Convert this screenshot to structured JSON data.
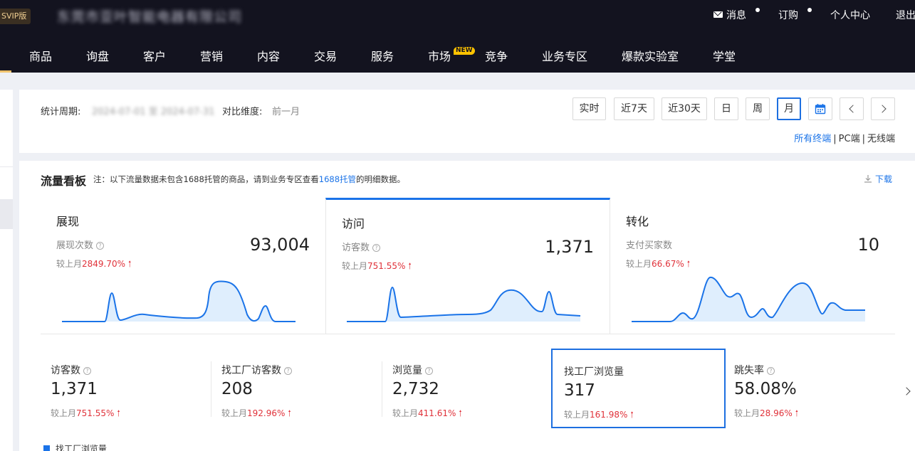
{
  "header": {
    "badge": "SVIP版",
    "company": "东莞市亚叶智能电器有限公司",
    "links": [
      {
        "label": "消息",
        "icon": "mail-icon"
      },
      {
        "label": "订购"
      },
      {
        "label": "个人中心"
      },
      {
        "label": "退出"
      }
    ]
  },
  "nav": {
    "items": [
      "商品",
      "询盘",
      "客户",
      "营销",
      "内容",
      "交易",
      "服务",
      "市场",
      "竞争",
      "业务专区",
      "爆款实验室",
      "学堂"
    ],
    "new_badge": "NEW"
  },
  "filter": {
    "period_label": "统计周期:",
    "period_value": "2024-07-01 至 2024-07-31",
    "compare_label": "对比维度:",
    "compare_value": "前一月",
    "buttons": [
      "实时",
      "近7天",
      "近30天",
      "日",
      "周",
      "月"
    ],
    "active_button": "月",
    "terminals": [
      "所有终端",
      "PC端",
      "无线端"
    ],
    "active_terminal": "所有终端",
    "separator": "|"
  },
  "dashboard": {
    "title": "流量看板",
    "note_prefix": "注：以下流量数据未包含1688托管的商品，请到业务专区查看",
    "note_link": "1688托管",
    "note_suffix": "的明细数据。",
    "download": "下载",
    "cards": [
      {
        "title": "展现",
        "metric": "展现次数",
        "value": "93,004",
        "compare_label": "较上月",
        "compare_value": "2849.70%",
        "help": "?"
      },
      {
        "title": "访问",
        "metric": "访客数",
        "value": "1,371",
        "compare_label": "较上月",
        "compare_value": "751.55%",
        "help": "?"
      },
      {
        "title": "转化",
        "metric": "支付买家数",
        "value": "10",
        "compare_label": "较上月",
        "compare_value": "66.67%",
        "help": ""
      }
    ],
    "metrics": [
      {
        "title": "访客数",
        "value": "1,371",
        "compare_label": "较上月",
        "compare_value": "751.55%",
        "help": "?"
      },
      {
        "title": "找工厂访客数",
        "value": "208",
        "compare_label": "较上月",
        "compare_value": "192.96%",
        "help": "?"
      },
      {
        "title": "浏览量",
        "value": "2,732",
        "compare_label": "较上月",
        "compare_value": "411.61%",
        "help": "?"
      },
      {
        "title": "找工厂浏览量",
        "value": "317",
        "compare_label": "较上月",
        "compare_value": "161.98%",
        "help": ""
      },
      {
        "title": "跳失率",
        "value": "58.08%",
        "compare_label": "较上月",
        "compare_value": "28.96%",
        "help": "?"
      }
    ],
    "selected_metric": "找工厂浏览量",
    "legend": "找工厂浏览量"
  },
  "colors": {
    "accent": "#1a73e8",
    "up": "#e0323a",
    "header_bg": "#13131f"
  }
}
